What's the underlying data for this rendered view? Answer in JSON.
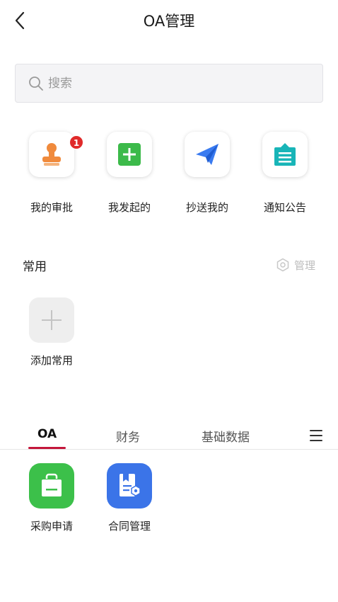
{
  "header": {
    "title": "OA管理",
    "back_icon": "chevron-left-icon"
  },
  "search": {
    "placeholder": "搜索",
    "icon": "search-icon"
  },
  "quick_actions": [
    {
      "label": "我的审批",
      "icon": "stamp-icon",
      "badge": "1",
      "color": "#f08a3c"
    },
    {
      "label": "我发起的",
      "icon": "plus-square-icon",
      "color": "#3cba4a"
    },
    {
      "label": "抄送我的",
      "icon": "paper-plane-icon",
      "color": "#3a7bf0"
    },
    {
      "label": "通知公告",
      "icon": "notice-board-icon",
      "color": "#18b5b8"
    }
  ],
  "common": {
    "title": "常用",
    "manage_label": "管理",
    "add_label": "添加常用"
  },
  "tabs": [
    {
      "label": "OA",
      "active": true
    },
    {
      "label": "财务",
      "active": false
    },
    {
      "label": "基础数据",
      "active": false
    }
  ],
  "tab_accent": "#c4163b",
  "apps": [
    {
      "label": "采购申请",
      "icon": "shopping-bag-icon",
      "color": "#3cc04a"
    },
    {
      "label": "合同管理",
      "icon": "contract-icon",
      "color": "#3b74e8"
    }
  ]
}
